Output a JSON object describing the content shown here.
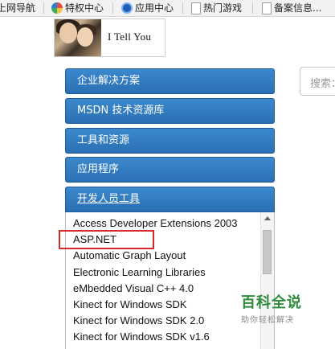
{
  "bookmarks": [
    {
      "label": "上网导航",
      "icon": "none"
    },
    {
      "label": "特权中心",
      "icon": "colorful-circle-icon"
    },
    {
      "label": "应用中心",
      "icon": "blue-circle-icon"
    },
    {
      "label": "热门游戏",
      "icon": "page-icon"
    },
    {
      "label": "备案信息...",
      "icon": "page-icon"
    }
  ],
  "logo": {
    "text": "I Tell You"
  },
  "search": {
    "placeholder": "搜索："
  },
  "menu": [
    {
      "label": "企业解决方案"
    },
    {
      "label": "MSDN 技术资源库"
    },
    {
      "label": "工具和资源"
    },
    {
      "label": "应用程序"
    },
    {
      "label": "开发人员工具",
      "expanded": true
    }
  ],
  "dev_tools_list": [
    "Access Developer Extensions 2003",
    "ASP.NET",
    "Automatic Graph Layout",
    "Electronic Learning Libraries",
    "eMbedded Visual C++ 4.0",
    "Kinect for Windows SDK",
    "Kinect for Windows SDK 2.0",
    "Kinect for Windows SDK v1.6"
  ],
  "highlighted_item": "ASP.NET",
  "watermark": {
    "title": "百科全说",
    "subtitle": "助你轻松解决"
  },
  "colors": {
    "menu_blue": "#2f7bbf",
    "highlight_red": "#d42a2a",
    "watermark_green": "#2e8b3a"
  }
}
